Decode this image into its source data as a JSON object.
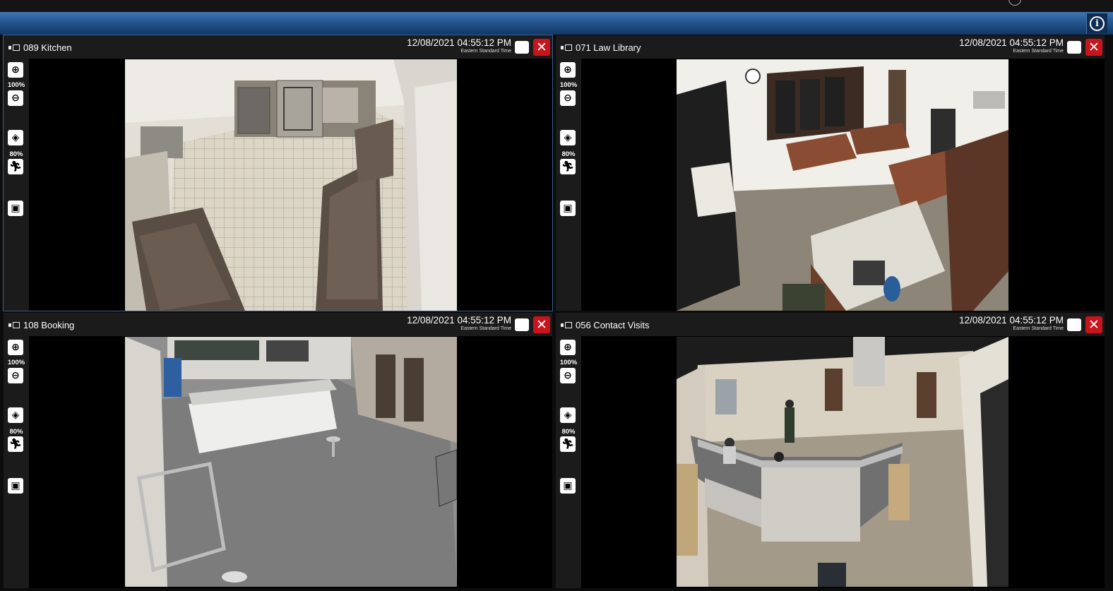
{
  "app": {
    "info_icon": "info-circle-icon"
  },
  "cameras": [
    {
      "name": "089 Kitchen",
      "datetime": "12/08/2021 04:55:12 PM",
      "timezone": "Eastern Standard Time",
      "zoom_level": "100%",
      "sensitivity_level": "80%",
      "selected": true
    },
    {
      "name": "071 Law Library",
      "datetime": "12/08/2021 04:55:12 PM",
      "timezone": "Eastern Standard Time",
      "zoom_level": "100%",
      "sensitivity_level": "80%",
      "selected": false
    },
    {
      "name": "108 Booking",
      "datetime": "12/08/2021 04:55:12 PM",
      "timezone": "Eastern Standard Time",
      "zoom_level": "100%",
      "sensitivity_level": "80%",
      "selected": false
    },
    {
      "name": "056 Contact Visits",
      "datetime": "12/08/2021 04:55:12 PM",
      "timezone": "Eastern Standard Time",
      "zoom_level": "100%",
      "sensitivity_level": "80%",
      "selected": false
    }
  ],
  "toolbar_icons": [
    "zoom-in-icon",
    "zoom-out-icon",
    "gem-icon",
    "motion-runner-icon",
    "clip-export-icon"
  ],
  "colors": {
    "header_blue": "#24558f",
    "close_red": "#c8141c"
  }
}
